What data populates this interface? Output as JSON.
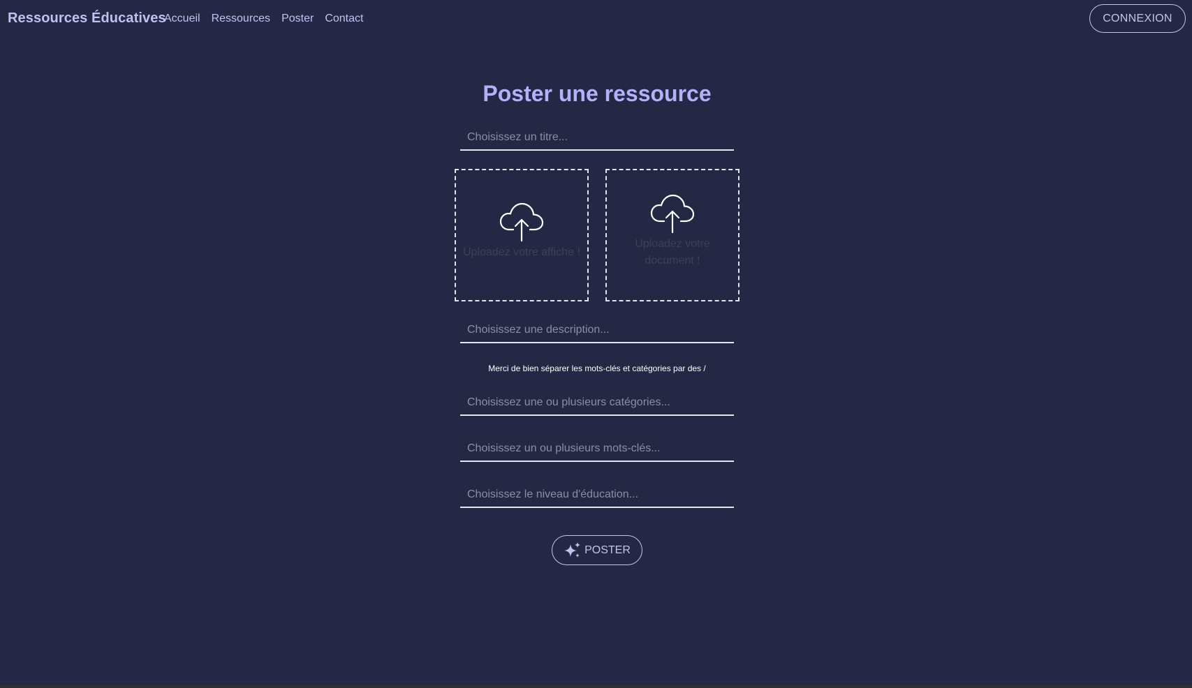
{
  "navbar": {
    "brand": "Ressources Éducatives",
    "links": [
      {
        "label": "Accueil"
      },
      {
        "label": "Ressources"
      },
      {
        "label": "Poster"
      },
      {
        "label": "Contact"
      }
    ],
    "login_label": "CONNEXION"
  },
  "form": {
    "title": "Poster une ressource",
    "title_placeholder": "Choisissez un titre...",
    "upload_poster_label": "Uploadez votre affiche !",
    "upload_document_label": "Uploadez votre document !",
    "upload_icon": "cloud-upload-icon",
    "description_placeholder": "Choisissez une description...",
    "hint": "Merci de bien séparer les mots-clés et catégories par des /",
    "categories_placeholder": "Choisissez une ou plusieurs catégories...",
    "keywords_placeholder": "Choisissez un ou plusieurs mots-clés...",
    "level_placeholder": "Choisissez le niveau d'éducation...",
    "submit_label": "POSTER",
    "submit_icon": "sparkles-icon"
  },
  "colors": {
    "background": "#242845",
    "accent": "#b5b0f7",
    "nav_text": "#c6c1ef",
    "field_border": "#e6e6f0"
  }
}
